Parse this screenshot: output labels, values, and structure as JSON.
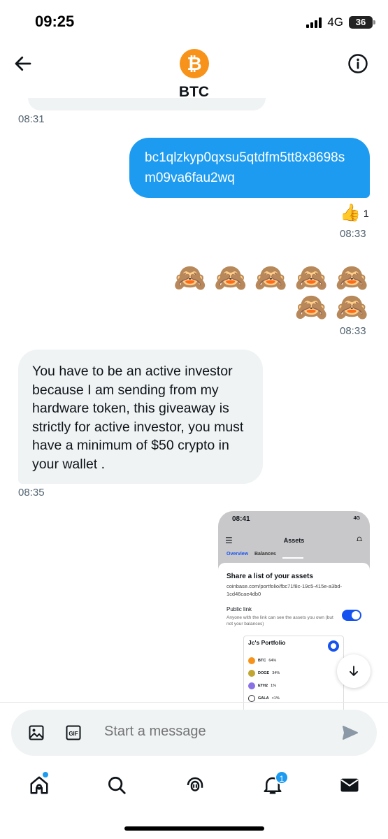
{
  "status_bar": {
    "time": "09:25",
    "network": "4G",
    "battery": "36"
  },
  "header": {
    "avatar_symbol": "₿",
    "title": "BTC",
    "avatar_color": "#f7931a"
  },
  "messages": {
    "ts1": "08:31",
    "outgoing_address": "bc1qlzkyp0qxsu5qtdfm5tt8x8698sm09va6fau2wq",
    "reaction_emoji": "👍",
    "reaction_count": "1",
    "ts2": "08:33",
    "emoji_row1": "🙈 🙈 🙈 🙈 🙈",
    "emoji_row2": "🙈 🙈",
    "ts3": "08:33",
    "incoming_text": "You have to be an active investor because I am sending from my hardware token, this giveaway is strictly for active investor, you must have a minimum of $50 crypto in your wallet .",
    "ts4": "08:35"
  },
  "shared_screenshot": {
    "time": "08:41",
    "status_right": "4G",
    "title": "Assets",
    "tab_overview": "Overview",
    "tab_balances": "Balances",
    "heading": "Share a list of your assets",
    "url": "coinbase.com/portfolio/fbc71f8c-19c5-415e-a3bd-1cd46cae4db0",
    "public_link_label": "Public link",
    "public_link_desc": "Anyone with the link can see the assets you own (but not your balances)",
    "portfolio_title": "Jc's Portfolio",
    "assets": [
      {
        "symbol": "BTC",
        "pct": "64%",
        "color": "#f7931a"
      },
      {
        "symbol": "DOGE",
        "pct": "34%",
        "color": "#c2a633"
      },
      {
        "symbol": "ETH2",
        "pct": "1%",
        "color": "#8a72e6"
      },
      {
        "symbol": "GALA",
        "pct": "<1%",
        "color": "#ffffff"
      }
    ]
  },
  "composer": {
    "placeholder": "Start a message"
  },
  "nav": {
    "notifications_badge": "1"
  },
  "colors": {
    "accent": "#1d9bf0",
    "bubble_incoming": "#eff3f4"
  }
}
